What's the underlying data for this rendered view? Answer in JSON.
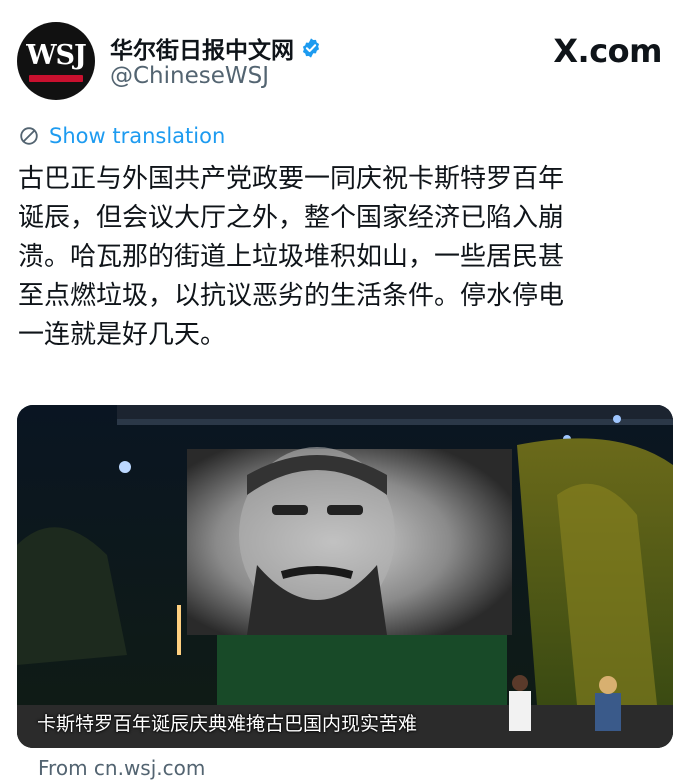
{
  "account": {
    "avatar_text": "WSJ",
    "display_name": "华尔街日报中文网",
    "handle": "@ChineseWSJ",
    "verified_icon": "verified-badge-icon"
  },
  "brand": {
    "site": "X.com"
  },
  "translate": {
    "icon": "translate-icon",
    "label": "Show translation"
  },
  "tweet": {
    "lines": [
      "古巴正与外国共产党政要一同庆祝卡斯特罗百年",
      "诞辰，但会议大厅之外，整个国家经济已陷入崩",
      "溃。哈瓦那的街道上垃圾堆积如山，一些居民甚",
      "至点燃垃圾，以抗议恶劣的生活条件。停水停电",
      "一连就是好几天。"
    ]
  },
  "media": {
    "caption": "卡斯特罗百年诞辰庆典难掩古巴国内现实苦难"
  },
  "link_card": {
    "source": "From cn.wsj.com"
  },
  "colors": {
    "accent": "#1d9bf0",
    "text": "#0f1419",
    "muted": "#536471",
    "wsj_red": "#c8102e"
  }
}
